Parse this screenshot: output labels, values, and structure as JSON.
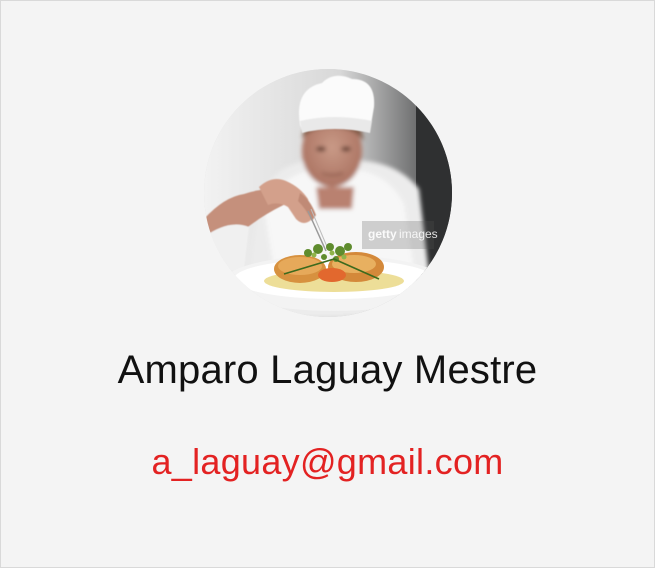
{
  "profile": {
    "name": "Amparo Laguay Mestre",
    "email": "a_laguay@gmail.com",
    "avatar_watermark": "gettyimages",
    "avatar_subject": "chef-plating-dish"
  },
  "colors": {
    "background": "#f4f4f4",
    "name_text": "#111111",
    "email_text": "#e32222"
  }
}
